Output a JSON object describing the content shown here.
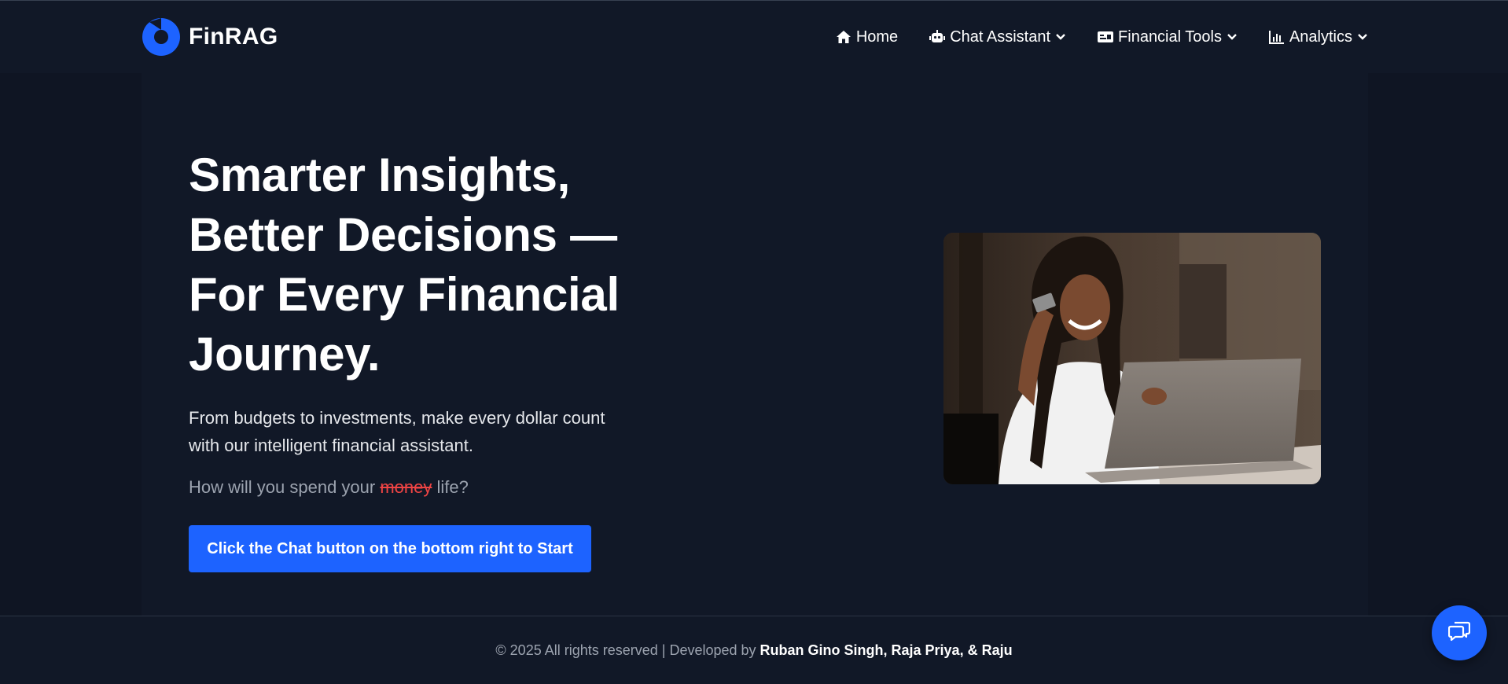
{
  "brand": {
    "name": "FinRAG",
    "logo_icon": "finrag-logo-icon",
    "accent": "#1d63ff"
  },
  "nav": {
    "items": [
      {
        "label": "Home",
        "icon": "home-icon"
      },
      {
        "label": "Chat Assistant",
        "icon": "robot-icon",
        "dropdown": true
      },
      {
        "label": "Financial Tools",
        "icon": "card-icon",
        "dropdown": true
      },
      {
        "label": "Analytics",
        "icon": "bar-chart-icon",
        "dropdown": true
      }
    ]
  },
  "hero": {
    "headline_lines": [
      "Smarter Insights,",
      "Better Decisions —",
      "For Every Financial",
      "Journey."
    ],
    "subtext_lines": [
      "From budgets to investments, make every dollar count",
      "with our intelligent financial assistant."
    ],
    "question_before": "How will you spend your",
    "question_struck": "money",
    "question_after": "life?",
    "cta_label": "Click the Chat button on the bottom right to Start"
  },
  "footer": {
    "text": "© 2025 All rights reserved | Developed by",
    "names": "Ruban Gino Singh, Raja Priya, & Raju"
  },
  "chat_fab": {
    "icon": "chat-bubbles-icon"
  },
  "colors": {
    "background": "#111827",
    "button": "#1d63ff",
    "muted_text": "#9ca3af",
    "strike": "#ef4444"
  }
}
